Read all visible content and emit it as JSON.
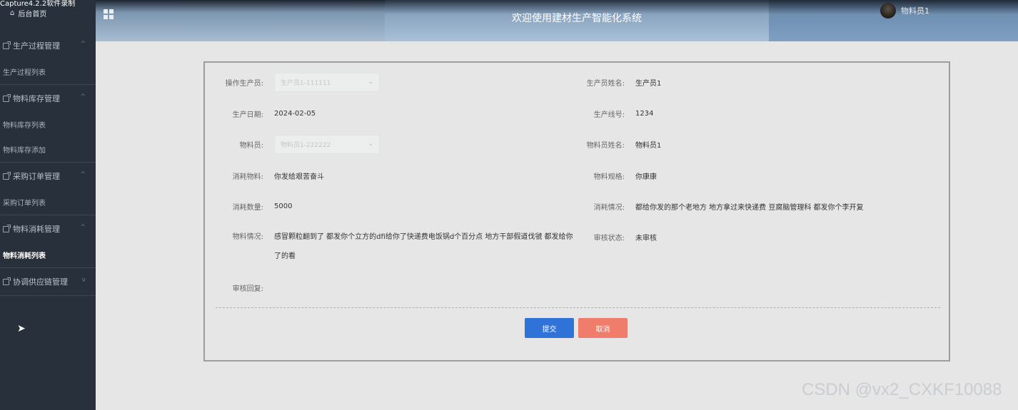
{
  "capture_label": "Capture4.2.2软件录制",
  "sidebar": {
    "home": "后台首页",
    "groups": [
      {
        "title": "生产过程管理",
        "chevron": "^",
        "items": [
          "生产过程列表"
        ]
      },
      {
        "title": "物料库存管理",
        "chevron": "^",
        "items": [
          "物料库存列表",
          "物料库存添加"
        ]
      },
      {
        "title": "采购订单管理",
        "chevron": "^",
        "items": [
          "采购订单列表"
        ]
      },
      {
        "title": "物料消耗管理",
        "chevron": "^",
        "items": [
          "物料消耗列表"
        ]
      },
      {
        "title": "协调供应链管理",
        "chevron": "v",
        "items": []
      }
    ],
    "active_item": "物料消耗列表"
  },
  "header": {
    "title": "欢迎使用建材生产智能化系统",
    "user": "物料员1"
  },
  "form": {
    "operator": {
      "label": "操作生产员:",
      "value": "生产员1-111111"
    },
    "producer_name": {
      "label": "生产员姓名:",
      "value": "生产员1"
    },
    "production_date": {
      "label": "生产日期:",
      "value": "2024-02-05"
    },
    "line_no": {
      "label": "生产线号:",
      "value": "1234"
    },
    "material_staff": {
      "label": "物料员:",
      "value": "物料员1-222222"
    },
    "material_staff_name": {
      "label": "物料员姓名:",
      "value": "物料员1"
    },
    "consumed_material": {
      "label": "消耗物料:",
      "value": "你发给艰苦奋斗"
    },
    "material_spec": {
      "label": "物料规格:",
      "value": "你康康"
    },
    "consumed_qty": {
      "label": "消耗数量:",
      "value": "5000"
    },
    "consumption_status": {
      "label": "消耗情况:",
      "value": "都给你发的那个老地方 地方拿过来快递费 豆腐脑管理科 都发你个李开复"
    },
    "material_status": {
      "label": "物料情况:",
      "value": "感冒颗粒翻到了 都发你个立方的dfi给你了快递费电饭锅d个百分点 地方干部假道伐虢 都发给你了的看"
    },
    "review_status": {
      "label": "审核状态:",
      "value": "未审核"
    },
    "review_reply": {
      "label": "审核回复:",
      "value": ""
    }
  },
  "buttons": {
    "submit": "提交",
    "cancel": "取消"
  },
  "watermark": "CSDN @vx2_CXKF10088",
  "colors": {
    "sidebar": "#28313b",
    "submit": "#2f73d9",
    "cancel": "#f07c6b"
  }
}
